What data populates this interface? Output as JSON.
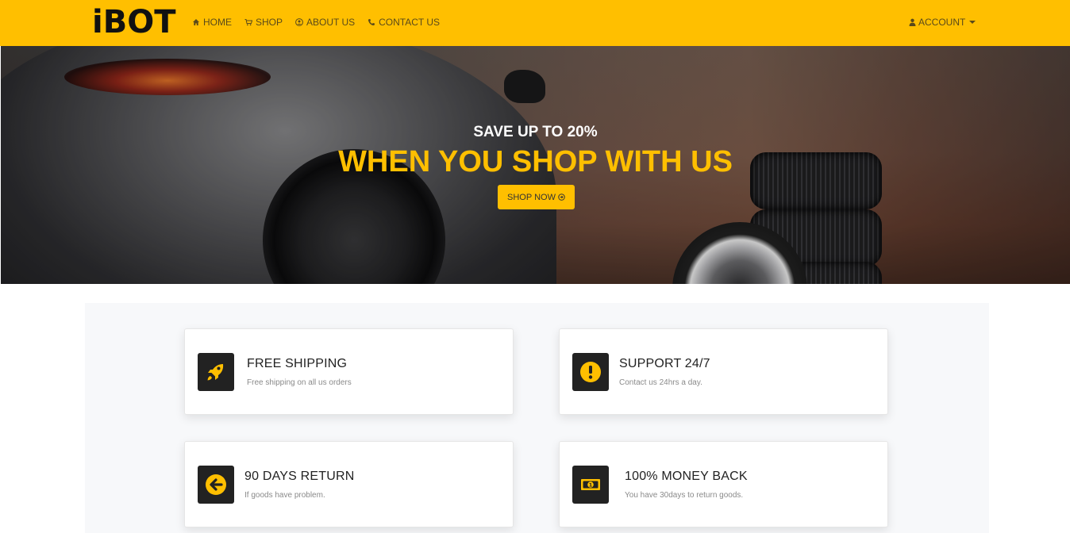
{
  "brand": {
    "logo": "iBOT"
  },
  "nav": {
    "items": [
      {
        "label": "HOME",
        "icon": "home-icon"
      },
      {
        "label": "SHOP",
        "icon": "cart-icon"
      },
      {
        "label": "ABOUT US",
        "icon": "user-circle-icon"
      },
      {
        "label": "CONTACT US",
        "icon": "phone-icon"
      }
    ],
    "account": {
      "label": "ACCOUNT",
      "icon": "user-icon"
    }
  },
  "hero": {
    "subtitle": "SAVE UP TO 20%",
    "title": "WHEN YOU SHOP WITH US",
    "button_label": "SHOP NOW"
  },
  "features": [
    {
      "title": "FREE SHIPPING",
      "desc": "Free shipping on all us orders",
      "icon": "rocket-icon"
    },
    {
      "title": "SUPPORT 24/7",
      "desc": "Contact us 24hrs a day.",
      "icon": "exclamation-circle-icon"
    },
    {
      "title": "90 DAYS RETURN",
      "desc": "If goods have problem.",
      "icon": "arrow-left-circle-icon"
    },
    {
      "title": "100% MONEY BACK",
      "desc": "You have 30days to return goods.",
      "icon": "money-icon"
    }
  ],
  "colors": {
    "accent": "#ffbf00",
    "dark": "#222222",
    "text_muted": "#8a8a8a"
  }
}
